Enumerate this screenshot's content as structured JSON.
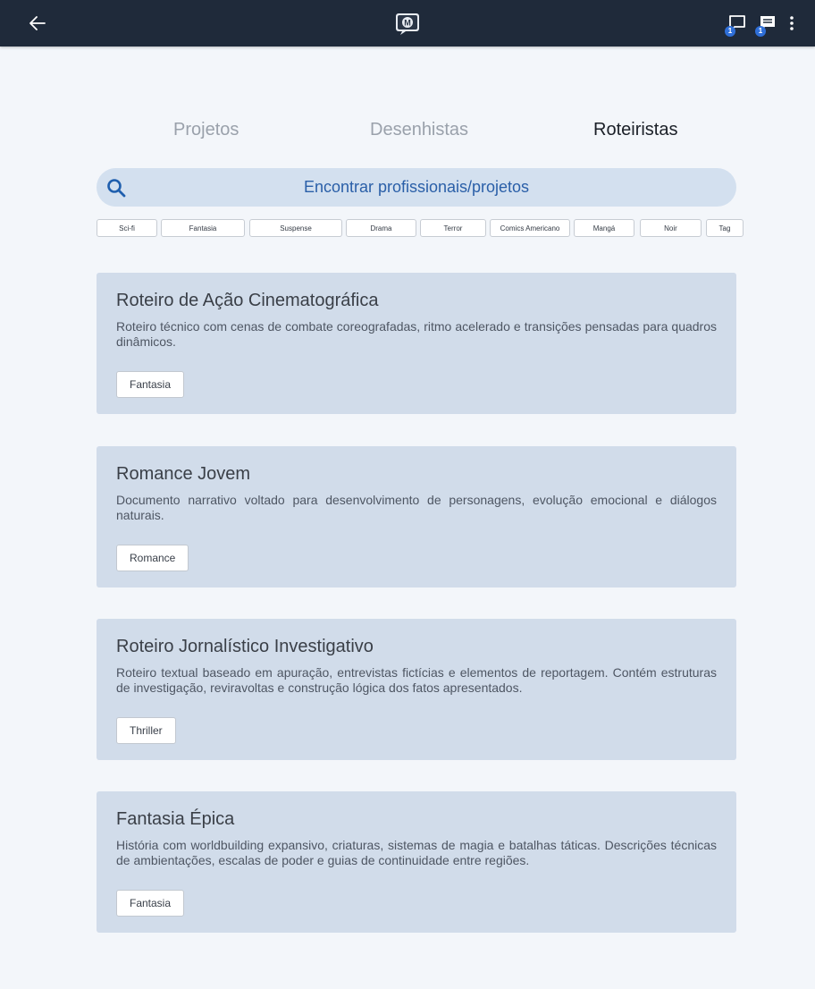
{
  "tabs": {
    "projetos": "Projetos",
    "desenhistas": "Desenhistas",
    "roteiristas": "Roteiristas"
  },
  "search": {
    "placeholder": "Encontrar profissionais/projetos"
  },
  "tags": [
    "Sci-fi",
    "Fantasia",
    "Suspense",
    "Drama",
    "Terror",
    "Comics Americano",
    "Mangá",
    "Noir",
    "Tag"
  ],
  "header": {
    "chat_badge_1": "1",
    "chat_badge_2": "1"
  },
  "cards": [
    {
      "title": "Roteiro de Ação Cinematográfica",
      "description": "Roteiro técnico com cenas de combate coreografadas, ritmo acelerado e transições pensadas para quadros dinâmicos.",
      "tag": "Fantasia"
    },
    {
      "title": "Romance Jovem",
      "description": "Documento narrativo voltado para desenvolvimento de personagens, evolução emocional e diálogos naturais.",
      "tag": "Romance"
    },
    {
      "title": "Roteiro Jornalístico Investigativo",
      "description": "Roteiro textual baseado em apuração, entrevistas fictícias e elementos de reportagem. Contém estruturas de investigação, reviravoltas e construção lógica dos fatos apresentados.",
      "tag": "Thriller"
    },
    {
      "title": "Fantasia Épica",
      "description": "História com worldbuilding expansivo, criaturas, sistemas de magia e batalhas táticas. Descrições técnicas de ambientações, escalas de poder e guias de continuidade entre regiões.",
      "tag": "Fantasia"
    }
  ],
  "colors": {
    "topbar": "#1f2a3a",
    "card_bg": "#d1dcea",
    "search_bg": "#d3e0ef",
    "accent": "#2a5fa8"
  }
}
